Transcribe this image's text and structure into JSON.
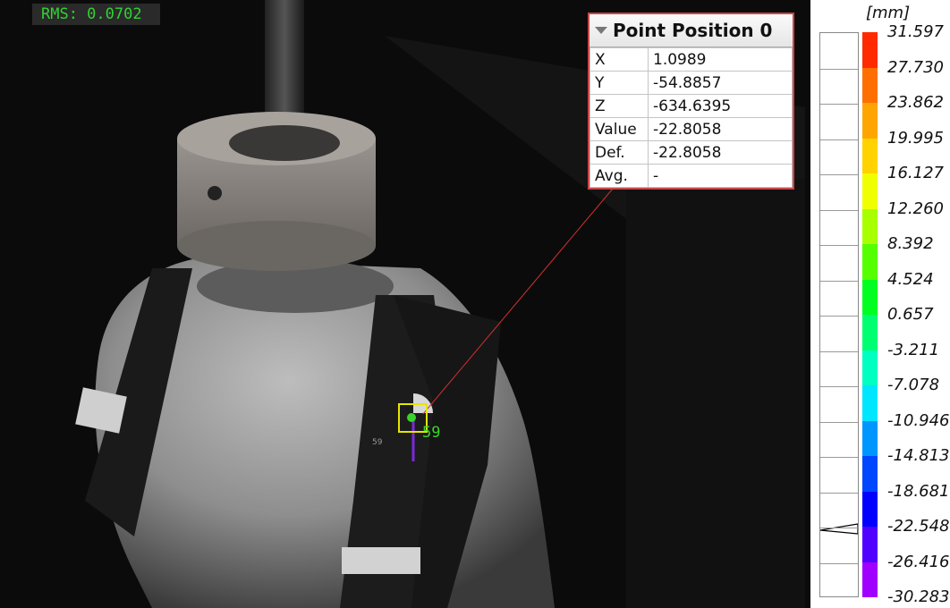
{
  "overlay": {
    "rms_text": "RMS: 0.0702",
    "point_marker_label": "59"
  },
  "point_panel": {
    "title": "Point Position 0",
    "rows": [
      {
        "key": "X",
        "value": "1.0989"
      },
      {
        "key": "Y",
        "value": "-54.8857"
      },
      {
        "key": "Z",
        "value": "-634.6395"
      },
      {
        "key": "Value",
        "value": "-22.8058"
      },
      {
        "key": "Def.",
        "value": "-22.8058"
      },
      {
        "key": "Avg.",
        "value": "-"
      }
    ]
  },
  "scale": {
    "unit": "[mm]",
    "labels": [
      "31.597",
      "27.730",
      "23.862",
      "19.995",
      "16.127",
      "12.260",
      "8.392",
      "4.524",
      "0.657",
      "-3.211",
      "-7.078",
      "-10.946",
      "-14.813",
      "-18.681",
      "-22.548",
      "-26.416",
      "-30.283"
    ],
    "colors": [
      "#ff2a00",
      "#ff6f00",
      "#ffa500",
      "#ffd200",
      "#f0ff00",
      "#a8ff00",
      "#55ff00",
      "#00ff20",
      "#00ff70",
      "#00ffc0",
      "#00e6ff",
      "#0096ff",
      "#0046ff",
      "#0000ff",
      "#5000ff",
      "#a000ff"
    ]
  },
  "colors": {
    "overlay_green": "#32d232",
    "marker_yellow": "#e6e600",
    "leader_line": "#d03030",
    "panel_border": "#c84646"
  }
}
